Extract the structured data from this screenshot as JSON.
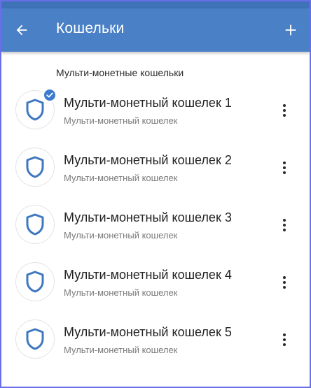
{
  "appbar": {
    "title": "Кошельки",
    "back_icon": "arrow-left-icon",
    "add_icon": "plus-icon",
    "color": "#4a80c6"
  },
  "section": {
    "header": "Мульти-монетные кошельки"
  },
  "wallets": [
    {
      "name": "Мульти-монетный кошелек 1",
      "type": "Мульти-монетный кошелек",
      "selected": true
    },
    {
      "name": "Мульти-монетный кошелек 2",
      "type": "Мульти-монетный кошелек",
      "selected": false
    },
    {
      "name": "Мульти-монетный кошелек 3",
      "type": "Мульти-монетный кошелек",
      "selected": false
    },
    {
      "name": "Мульти-монетный кошелек 4",
      "type": "Мульти-монетный кошелек",
      "selected": false
    },
    {
      "name": "Мульти-монетный кошелек 5",
      "type": "Мульти-монетный кошелек",
      "selected": false
    }
  ],
  "icons": {
    "wallet": "shield-icon",
    "selected": "check-badge-icon",
    "menu": "more-vertical-icon"
  },
  "colors": {
    "accent": "#3d7bcf",
    "shield_stroke": "#3f78c0"
  }
}
